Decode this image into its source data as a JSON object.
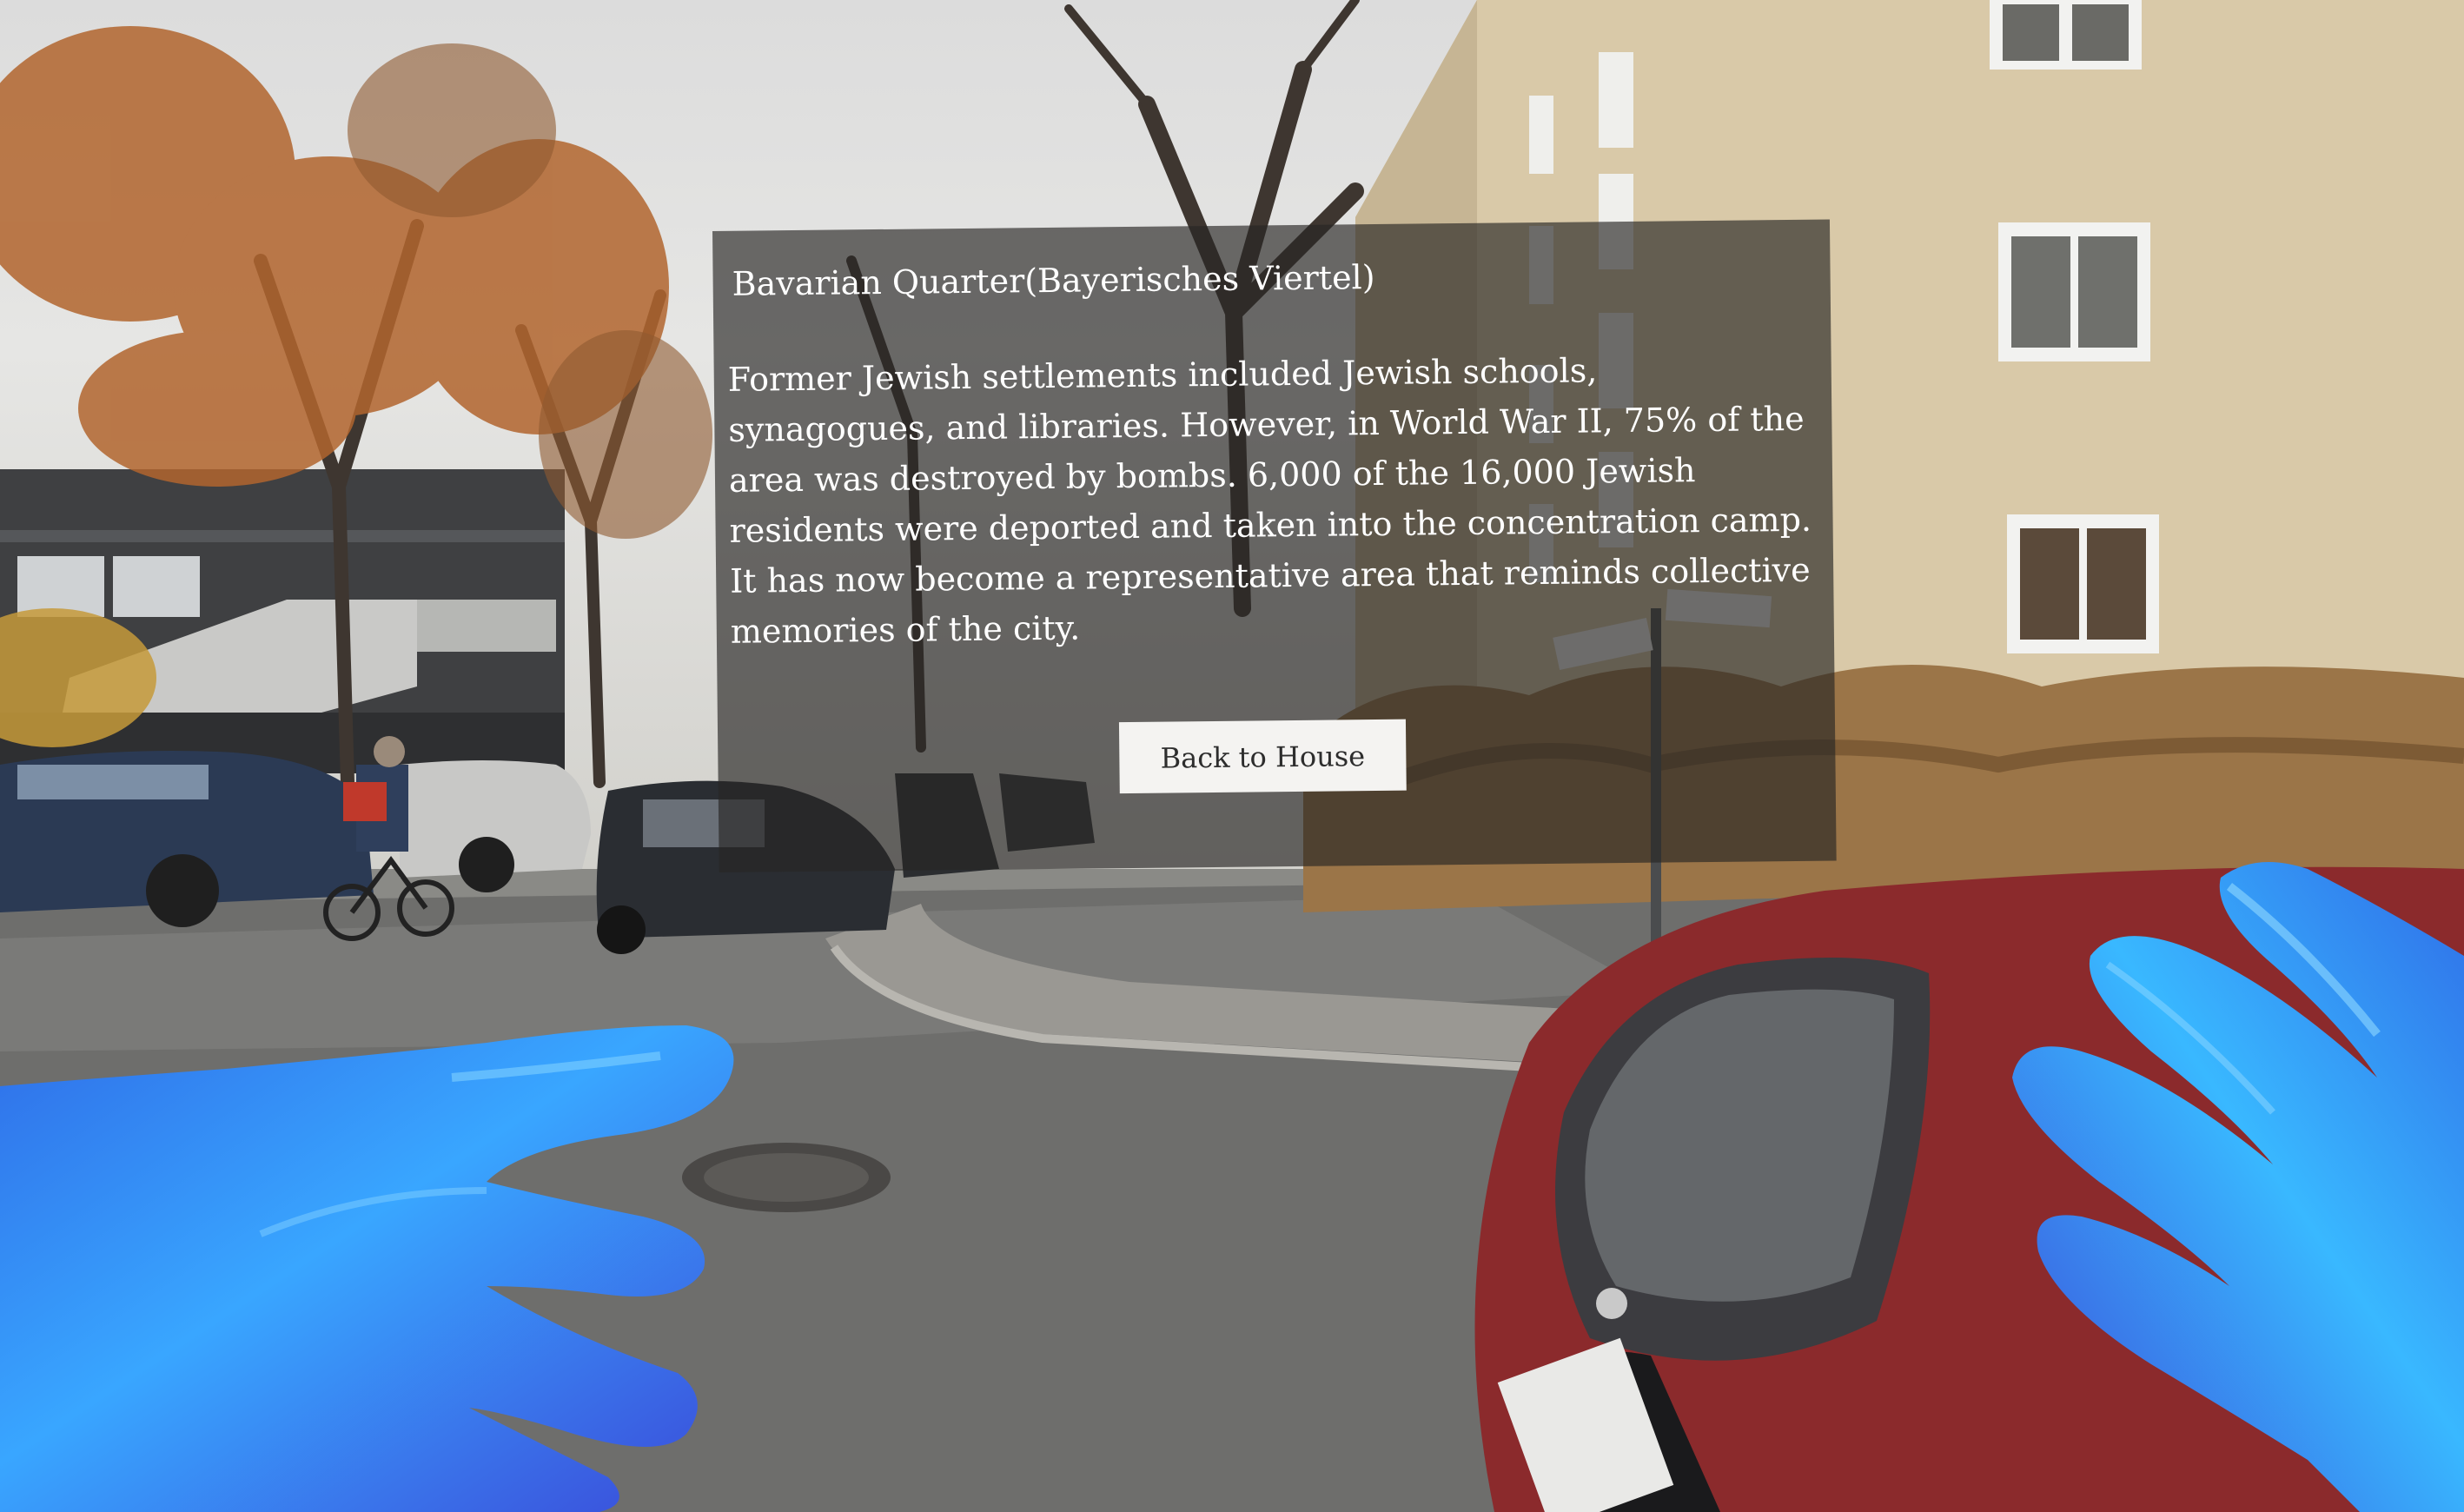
{
  "panel": {
    "title": "Bavarian Quarter(Bayerisches Viertel)",
    "body": "Former Jewish settlements included Jewish schools, synagogues, and libraries. However, in World War II, 75% of the area was destroyed by bombs. 6,000 of the 16,000 Jewish residents were deported and taken into the concentration camp. It has now become a representative area that reminds collective memories of the city.",
    "back_button_label": "Back to House"
  },
  "colors": {
    "panel_background": "#282624",
    "button_background": "#f4f3f1",
    "hand_light": "#39b8ff",
    "hand_dark": "#3a48d8"
  },
  "icons": {
    "left_hand": "virtual-left-hand",
    "right_hand": "virtual-right-hand"
  }
}
